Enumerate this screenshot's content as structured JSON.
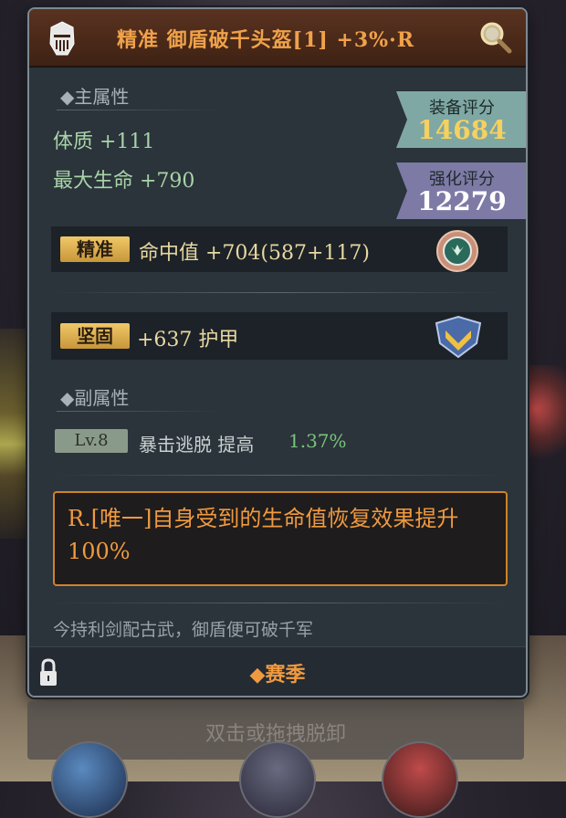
{
  "header": {
    "title": "精准 御盾破千头盔[1] +3%·R",
    "helm_icon": "knight-helmet-icon",
    "search_icon": "magnifier-icon"
  },
  "main_attr": {
    "heading": "◆主属性",
    "stats": [
      "体质 +111",
      "最大生命 +790"
    ]
  },
  "scores": {
    "equip_label": "装备评分",
    "equip_value": "14684",
    "enhance_label": "强化评分",
    "enhance_value": "12279"
  },
  "precision_row": {
    "tag": "精准",
    "text": "命中值 +704(587+117)",
    "icon": "emblem-badge-icon"
  },
  "sturdy_row": {
    "tag": "坚固",
    "text": "+637 护甲",
    "icon": "shield-chevron-icon"
  },
  "sub_attr": {
    "heading": "◆副属性",
    "level": "Lv.8",
    "text": "暴击逃脱 提高",
    "value": "1.37%"
  },
  "special": {
    "text": "R.[唯一]自身受到的生命值恢复效果提升100%"
  },
  "flavor": "今持利剑配古武，御盾便可破千军",
  "footer": {
    "label": "◆赛季",
    "lock_icon": "lock-icon"
  },
  "unequip_hint": "双击或拖拽脱卸",
  "colors": {
    "accent_orange": "#f09a40",
    "stat_green": "#a8d4a8",
    "gold_tag": "#e0b050"
  }
}
